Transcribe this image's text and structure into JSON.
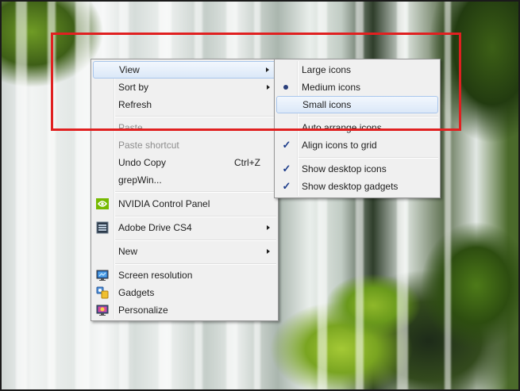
{
  "context_menu": {
    "items": [
      {
        "label": "View",
        "submenu": true,
        "hovered": true
      },
      {
        "label": "Sort by",
        "submenu": true
      },
      {
        "label": "Refresh"
      },
      {
        "label": "Paste",
        "disabled": true
      },
      {
        "label": "Paste shortcut",
        "disabled": true
      },
      {
        "label": "Undo Copy",
        "shortcut": "Ctrl+Z"
      },
      {
        "label": "grepWin..."
      },
      {
        "label": "NVIDIA Control Panel",
        "icon": "nvidia-icon"
      },
      {
        "label": "Adobe Drive CS4",
        "icon": "adobe-drive-icon",
        "submenu": true
      },
      {
        "label": "New",
        "submenu": true
      },
      {
        "label": "Screen resolution",
        "icon": "monitor-icon"
      },
      {
        "label": "Gadgets",
        "icon": "gadgets-icon"
      },
      {
        "label": "Personalize",
        "icon": "personalize-icon"
      }
    ]
  },
  "view_submenu": {
    "items": [
      {
        "label": "Large icons"
      },
      {
        "label": "Medium icons",
        "selected": true
      },
      {
        "label": "Small icons",
        "hovered": true
      },
      {
        "label": "Auto arrange icons"
      },
      {
        "label": "Align icons to grid",
        "checked": true
      },
      {
        "label": "Show desktop icons",
        "checked": true
      },
      {
        "label": "Show desktop gadgets",
        "checked": true
      }
    ]
  },
  "colors": {
    "highlight_rect": "#e02020",
    "menu_bg": "#f0f0f0",
    "hover_bg": "#dbe8f8"
  }
}
